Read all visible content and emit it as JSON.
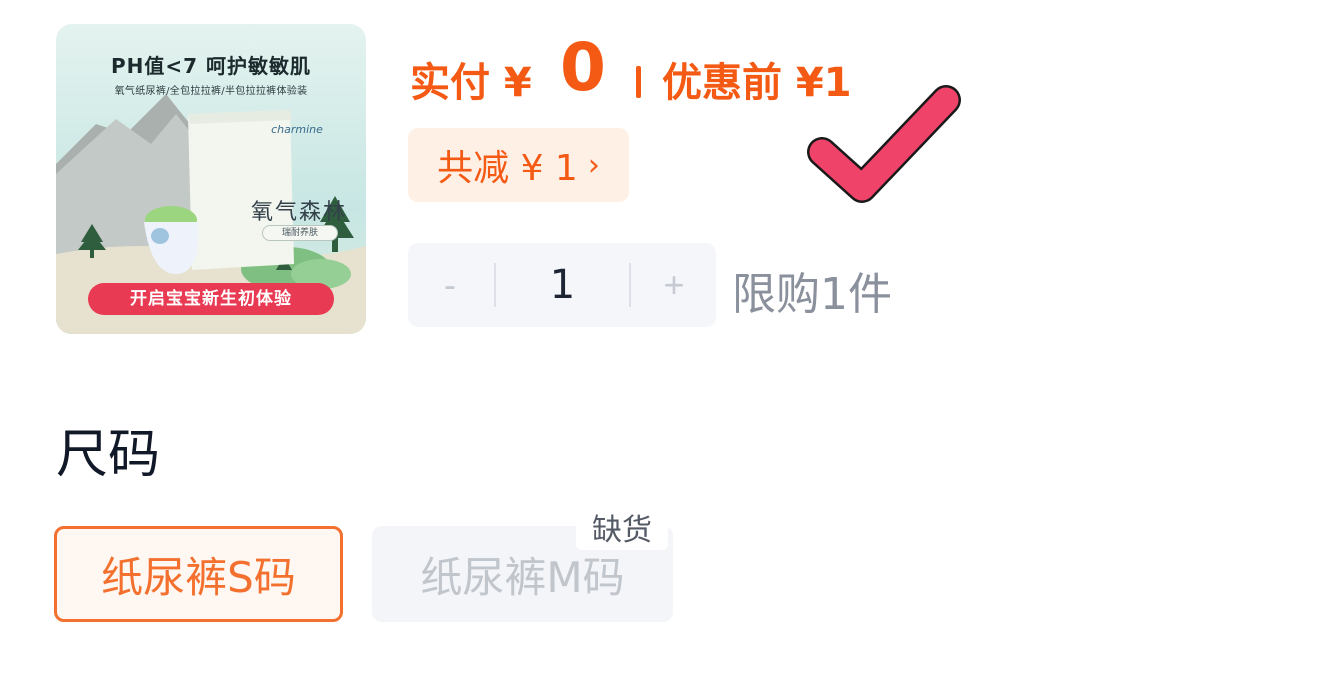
{
  "product": {
    "image": {
      "headline": "PH值<7  呵护敏敏肌",
      "subline": "氧气纸尿裤/全包拉拉裤/半包拉拉裤体验装",
      "brand": "charmine",
      "pack_title": "氧气森林",
      "pack_sub": "瑞耐养肤",
      "banner": "开启宝宝新生初体验"
    }
  },
  "price": {
    "pay_label": "实付 ¥",
    "pay_value": "0",
    "before_label": "优惠前 ¥1",
    "accent_color": "#f45a14"
  },
  "discount": {
    "label": "共减 ¥ 1",
    "chevron": "›"
  },
  "quantity": {
    "minus": "-",
    "value": "1",
    "plus": "+",
    "limit_text": "限购1件"
  },
  "sizes": {
    "title": "尺码",
    "options": [
      {
        "label": "纸尿裤S码",
        "selected": true
      },
      {
        "label": "纸尿裤M码",
        "selected": false,
        "badge": "缺货"
      }
    ]
  },
  "overlay": {
    "icon": "checkmark-icon",
    "color": "#f0436a"
  }
}
